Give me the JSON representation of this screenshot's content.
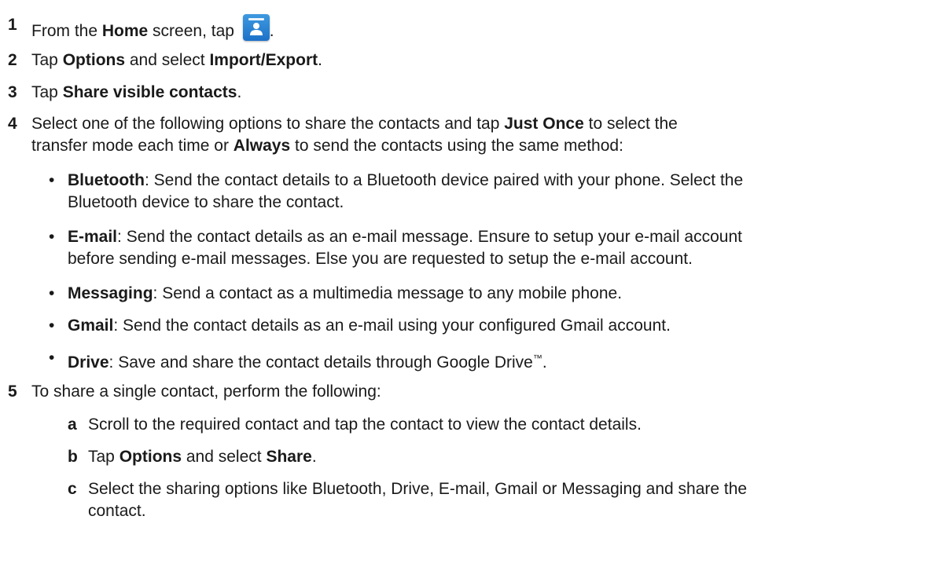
{
  "steps": [
    {
      "num": "1",
      "pre": "From the ",
      "b1": "Home",
      "mid": " screen, tap ",
      "post": "."
    },
    {
      "num": "2",
      "pre": "Tap ",
      "b1": "Options",
      "mid": " and select ",
      "b2": "Import/Export",
      "post": "."
    },
    {
      "num": "3",
      "pre": "Tap ",
      "b1": "Share visible contacts",
      "post": "."
    },
    {
      "num": "4",
      "pre": "Select one of the following options to share the contacts and tap ",
      "b1": "Just Once",
      "mid": " to select the",
      "line2_pre": "transfer mode each time or ",
      "b2": "Always",
      "line2_post": " to send the contacts using the same method:"
    },
    {
      "num": "5",
      "text": "To share a single contact, perform the following:"
    }
  ],
  "icon": "contacts-app-icon",
  "bullets": [
    {
      "term": "Bluetooth",
      "line1": ": Send the contact details to a Bluetooth device paired with your phone. Select the",
      "line2": "Bluetooth device to share the contact."
    },
    {
      "term": "E-mail",
      "line1": ": Send the contact details as an e-mail message. Ensure to setup your e-mail account",
      "line2": "before sending e-mail messages. Else you are requested to setup the e-mail account."
    },
    {
      "term": "Messaging",
      "line1": ": Send a contact as a multimedia message to any mobile phone."
    },
    {
      "term": "Gmail",
      "line1": ": Send the contact details as an e-mail using your configured Gmail account."
    },
    {
      "term": "Drive",
      "line1": ": Save and share the contact details through Google Drive",
      "tm": "™",
      "post": "."
    }
  ],
  "bullet_char": "•",
  "substeps": [
    {
      "letter": "a",
      "text": "Scroll to the required contact and tap the contact to view the contact details."
    },
    {
      "letter": "b",
      "pre": "Tap ",
      "b1": "Options",
      "mid": " and select ",
      "b2": "Share",
      "post": "."
    },
    {
      "letter": "c",
      "line1": "Select the sharing options like Bluetooth, Drive, E-mail, Gmail or Messaging and share the",
      "line2": "contact."
    }
  ]
}
